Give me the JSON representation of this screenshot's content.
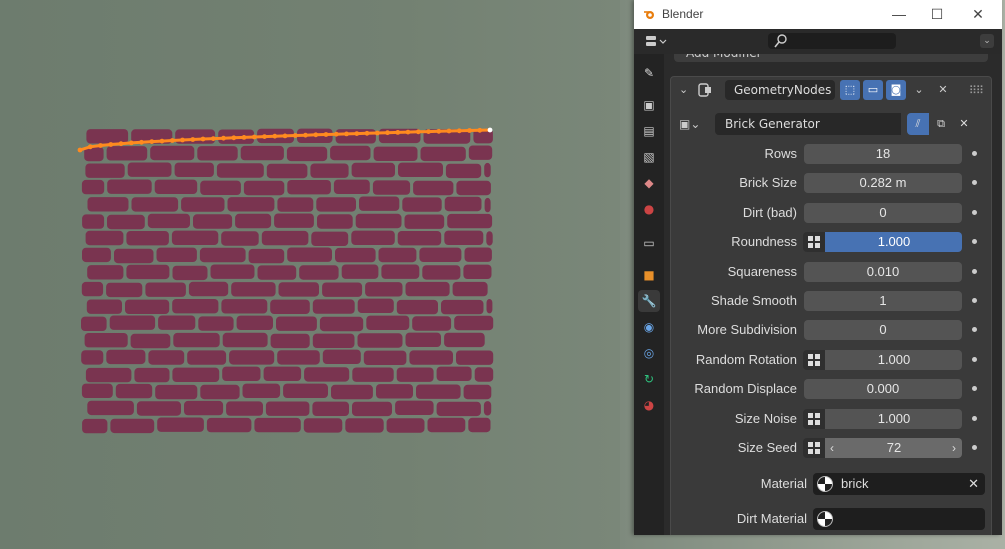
{
  "window": {
    "title": "Blender",
    "controls": {
      "minimize": "—",
      "maximize": "☐",
      "close": "✕"
    }
  },
  "header": {
    "search_placeholder": "",
    "search_icon": "search-icon"
  },
  "add_modifier_label": "Add Modifier",
  "modifier": {
    "name": "GeometryNodes",
    "node_group": "Brick Generator"
  },
  "properties": [
    {
      "label": "Rows",
      "value": "18",
      "type": "number"
    },
    {
      "label": "Brick Size",
      "value": "0.282 m",
      "type": "number"
    },
    {
      "label": "Dirt (bad)",
      "value": "0",
      "type": "number"
    },
    {
      "label": "Roundness",
      "value": "1.000",
      "type": "slider-selected"
    },
    {
      "label": "Squareness",
      "value": "0.010",
      "type": "number"
    },
    {
      "label": "Shade Smooth",
      "value": "1",
      "type": "number"
    },
    {
      "label": "More Subdivision",
      "value": "0",
      "type": "number"
    },
    {
      "label": "Random Rotation",
      "value": "1.000",
      "type": "slider"
    },
    {
      "label": "Random Displace",
      "value": "0.000",
      "type": "number"
    },
    {
      "label": "Size Noise",
      "value": "1.000",
      "type": "slider"
    },
    {
      "label": "Size Seed",
      "value": "72",
      "type": "stepper-hover"
    }
  ],
  "materials": [
    {
      "label": "Material",
      "value": "brick"
    },
    {
      "label": "Dirt Material",
      "value": ""
    }
  ],
  "colors": {
    "brick": "#7a3450",
    "selection_edge": "#ff8a1f",
    "accent_blue": "#4772b3",
    "panel_bg": "#303030"
  }
}
